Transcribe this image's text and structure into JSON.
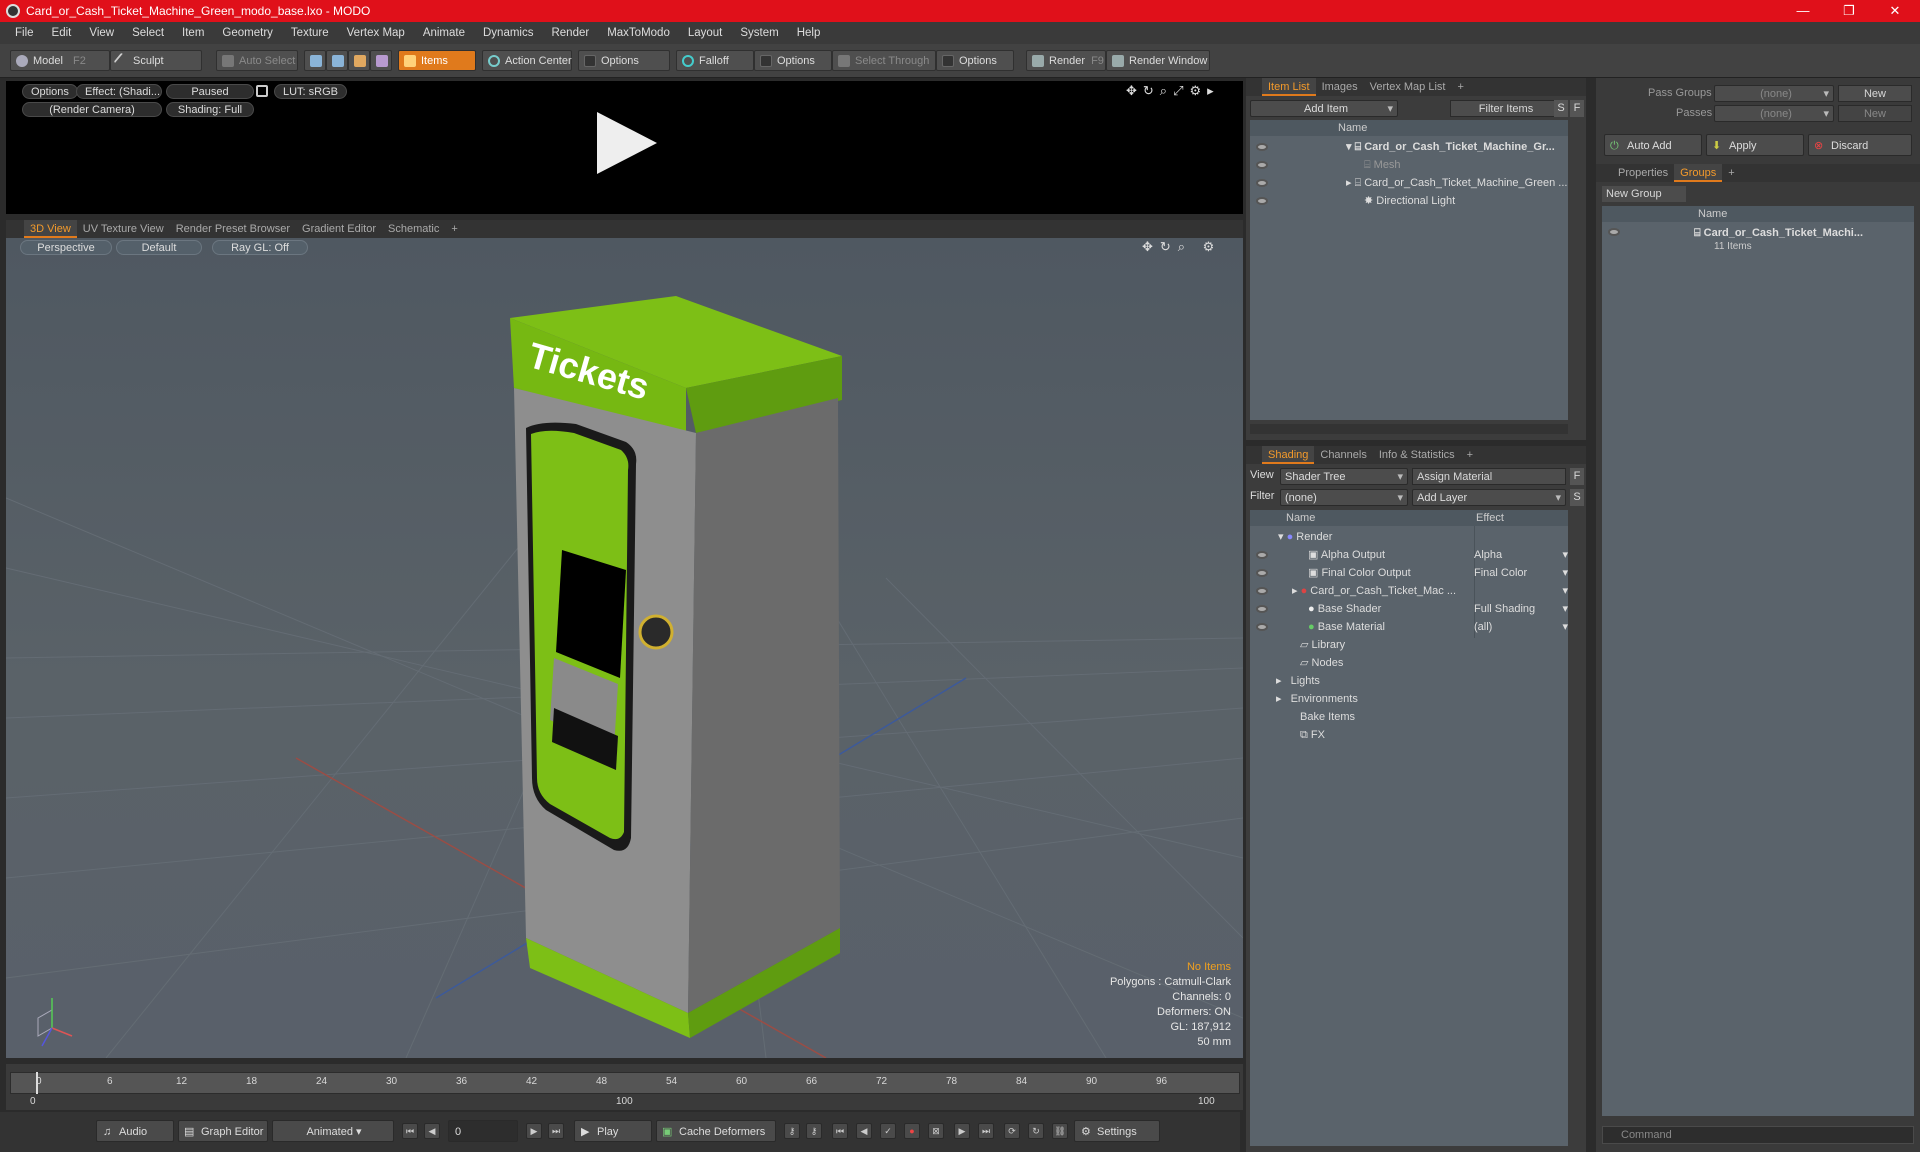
{
  "window": {
    "title": "Card_or_Cash_Ticket_Machine_Green_modo_base.lxo - MODO",
    "min": "—",
    "max": "❐",
    "close": "✕"
  },
  "menu": [
    "File",
    "Edit",
    "View",
    "Select",
    "Item",
    "Geometry",
    "Texture",
    "Vertex Map",
    "Animate",
    "Dynamics",
    "Render",
    "MaxToModo",
    "Layout",
    "System",
    "Help"
  ],
  "toolbar": {
    "model": "Model",
    "model_key": "F2",
    "sculpt": "Sculpt",
    "auto_select": "Auto Select",
    "items": "Items",
    "action_center": "Action Center",
    "options1": "Options",
    "falloff": "Falloff",
    "options2": "Options",
    "select_through": "Select Through",
    "options3": "Options",
    "render": "Render",
    "render_key": "F9",
    "render_window": "Render Window"
  },
  "preview": {
    "options": "Options",
    "effect": "Effect: (Shadi...",
    "paused": "Paused",
    "lut": "LUT: sRGB",
    "camera": "(Render Camera)",
    "shading": "Shading: Full"
  },
  "viewtabs": [
    "3D View",
    "UV Texture View",
    "Render Preset Browser",
    "Gradient Editor",
    "Schematic",
    "+"
  ],
  "viewport": {
    "projection": "Perspective",
    "style": "Default",
    "raygl": "Ray GL: Off",
    "info": {
      "selection": "No Items",
      "polygons": "Polygons : Catmull-Clark",
      "channels": "Channels: 0",
      "deformers": "Deformers: ON",
      "gl": "GL: 187,912",
      "scale": "50 mm"
    },
    "model_sign": "Tickets"
  },
  "timeline": {
    "ticks": [
      "0",
      "6",
      "12",
      "18",
      "24",
      "30",
      "36",
      "42",
      "48",
      "54",
      "60",
      "66",
      "72",
      "78",
      "84",
      "90",
      "96"
    ],
    "start": "0",
    "end": "100",
    "mid": "100"
  },
  "bottom": {
    "audio": "Audio",
    "graph_editor": "Graph Editor",
    "animated": "Animated",
    "frame": "0",
    "play": "Play",
    "cache": "Cache Deformers",
    "settings": "Settings"
  },
  "itemlist": {
    "tabs": [
      "Item List",
      "Images",
      "Vertex Map List",
      "+"
    ],
    "add_item": "Add Item",
    "filter": "Filter Items",
    "s": "S",
    "f": "F",
    "col_name": "Name",
    "rows": [
      "Card_or_Cash_Ticket_Machine_Gr...",
      "Mesh",
      "Card_or_Cash_Ticket_Machine_Green ...",
      "Directional Light"
    ]
  },
  "shading": {
    "tabs": [
      "Shading",
      "Channels",
      "Info & Statistics",
      "+"
    ],
    "view_label": "View",
    "view_value": "Shader Tree",
    "assign": "Assign Material",
    "f": "F",
    "filter_label": "Filter",
    "filter_value": "(none)",
    "add_layer": "Add Layer",
    "s": "S",
    "col_name": "Name",
    "col_effect": "Effect",
    "rows": [
      {
        "name": "Render",
        "effect": ""
      },
      {
        "name": "Alpha Output",
        "effect": "Alpha"
      },
      {
        "name": "Final Color Output",
        "effect": "Final Color"
      },
      {
        "name": "Card_or_Cash_Ticket_Mac ...",
        "effect": ""
      },
      {
        "name": "Base Shader",
        "effect": "Full Shading"
      },
      {
        "name": "Base Material",
        "effect": "(all)"
      },
      {
        "name": "Library",
        "effect": ""
      },
      {
        "name": "Nodes",
        "effect": ""
      },
      {
        "name": "Lights",
        "effect": ""
      },
      {
        "name": "Environments",
        "effect": ""
      },
      {
        "name": "Bake Items",
        "effect": ""
      },
      {
        "name": "FX",
        "effect": ""
      }
    ]
  },
  "passes": {
    "pass_groups": "Pass Groups",
    "passes": "Passes",
    "none1": "(none)",
    "none2": "(none)",
    "new1": "New",
    "new2": "New",
    "auto_add": "Auto Add",
    "apply": "Apply",
    "discard": "Discard"
  },
  "groups": {
    "tabs": [
      "Properties",
      "Groups",
      "+"
    ],
    "new_group": "New Group",
    "col_name": "Name",
    "item_name": "Card_or_Cash_Ticket_Machi...",
    "item_count": "11 Items"
  },
  "command": {
    "placeholder": "Command"
  }
}
